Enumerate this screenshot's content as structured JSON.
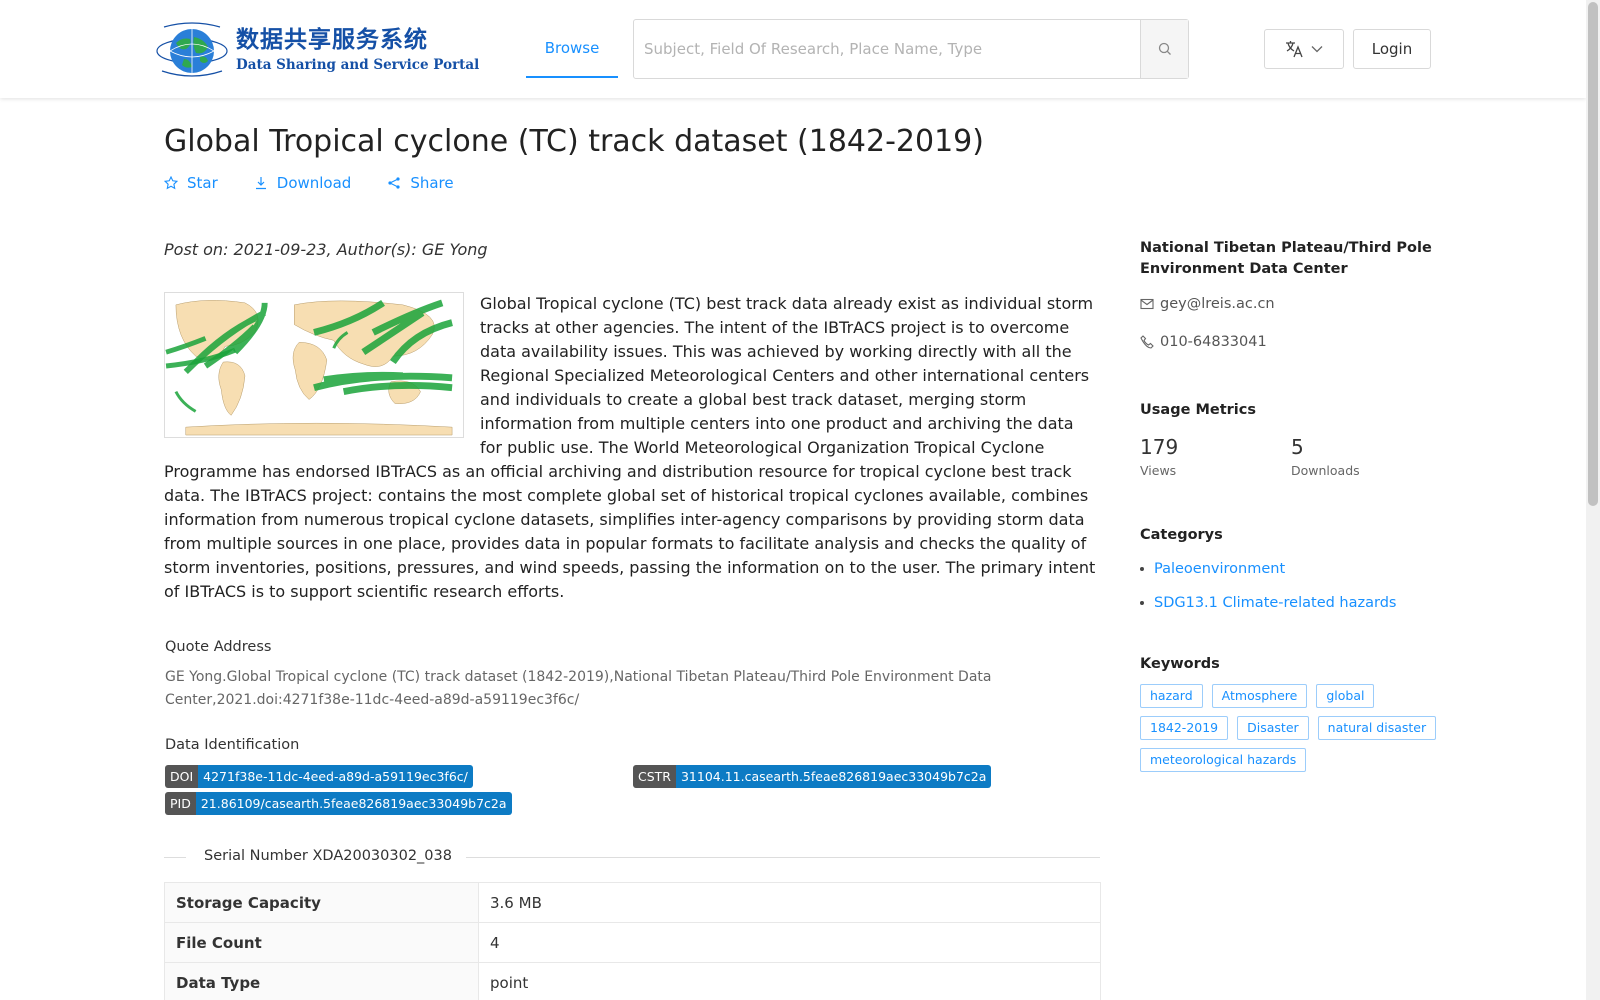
{
  "header": {
    "logo_cn": "数据共享服务系统",
    "logo_en": "Data Sharing and Service Portal",
    "nav_browse": "Browse",
    "search_placeholder": "Subject, Field Of Research, Place Name, Type",
    "login_label": "Login",
    "icons": {
      "search": "search-icon",
      "language": "translate-icon",
      "chevron": "chevron-down-icon"
    }
  },
  "dataset": {
    "title": "Global Tropical cyclone (TC) track dataset (1842-2019)",
    "actions": {
      "star": "Star",
      "download": "Download",
      "share": "Share"
    },
    "post_on": "Post on: 2021-09-23, Author(s): GE Yong",
    "description": "Global Tropical cyclone (TC) best track data already exist as individual storm tracks at other agencies. The intent of the IBTrACS project is to overcome data availability issues. This was achieved by working directly with all the Regional Specialized Meteorological Centers and other international centers and individuals to create a global best track dataset, merging storm information from multiple centers into one product and archiving the data for public use. The World Meteorological Organization Tropical Cyclone Programme has endorsed IBTrACS as an official archiving and distribution resource for tropical cyclone best track data. The IBTrACS project: contains the most complete global set of historical tropical cyclones available, combines information from numerous tropical cyclone datasets, simplifies inter-agency comparisons by providing storm data from multiple sources in one place, provides data in popular formats to facilitate analysis and checks the quality of storm inventories, positions, pressures, and wind speeds, passing the information on to the user. The primary intent of IBTrACS is to support scientific research efforts.",
    "quote_label": "Quote Address",
    "quote_text": "GE Yong.Global Tropical cyclone (TC) track dataset (1842-2019),National Tibetan Plateau/Third Pole Environment Data Center,2021.doi:4271f38e-11dc-4eed-a89d-a59119ec3f6c/",
    "identification_label": "Data Identification",
    "ids": {
      "doi_key": "DOI",
      "doi_value": "4271f38e-11dc-4eed-a89d-a59119ec3f6c/",
      "cstr_key": "CSTR",
      "cstr_value": "31104.11.casearth.5feae826819aec33049b7c2a",
      "pid_key": "PID",
      "pid_value": "21.86109/casearth.5feae826819aec33049b7c2a"
    },
    "serial_number": "Serial Number XDA20030302_038",
    "info_rows": [
      {
        "key": "Storage Capacity",
        "value": "3.6 MB"
      },
      {
        "key": "File Count",
        "value": "4"
      },
      {
        "key": "Data Type",
        "value": "point"
      }
    ]
  },
  "sidebar": {
    "org": "National Tibetan Plateau/Third Pole Environment Data Center",
    "email": "gey@lreis.ac.cn",
    "phone": "010-64833041",
    "metrics_title": "Usage Metrics",
    "views_count": "179",
    "views_label": "Views",
    "downloads_count": "5",
    "downloads_label": "Downloads",
    "categories_title": "Categorys",
    "categories": [
      "Paleoenvironment",
      "SDG13.1 Climate-related hazards"
    ],
    "keywords_title": "Keywords",
    "keywords": [
      "hazard",
      "Atmosphere",
      "global",
      "1842-2019",
      "Disaster",
      "natural disaster",
      "meteorological hazards"
    ]
  },
  "colors": {
    "link": "#1890ff",
    "badge_value": "#0d7bc4",
    "badge_key": "#555555",
    "logo": "#1550a6"
  }
}
